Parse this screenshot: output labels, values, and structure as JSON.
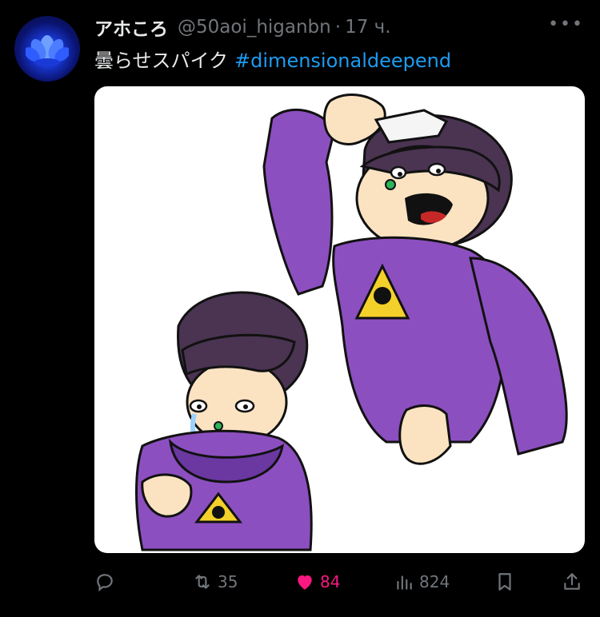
{
  "author": {
    "name": "アホころ",
    "handle": "@50aoi_higanbn",
    "separator": "·",
    "time": "17 ч.",
    "more_label": "•••"
  },
  "post": {
    "text": "曇らせスパイク",
    "hashtag": "#dimensionaldeepend"
  },
  "media": {
    "description_icon": "illustration"
  },
  "actions": {
    "reply_icon": "reply-icon",
    "retweet_count": "35",
    "like_count": "84",
    "views_count": "824",
    "bookmark_icon": "bookmark-icon",
    "share_icon": "share-icon"
  },
  "colors": {
    "background": "#000000",
    "accent": "#1d9bf0",
    "like": "#f91880",
    "muted": "#71767b",
    "shirt": "#8c4fc0"
  }
}
